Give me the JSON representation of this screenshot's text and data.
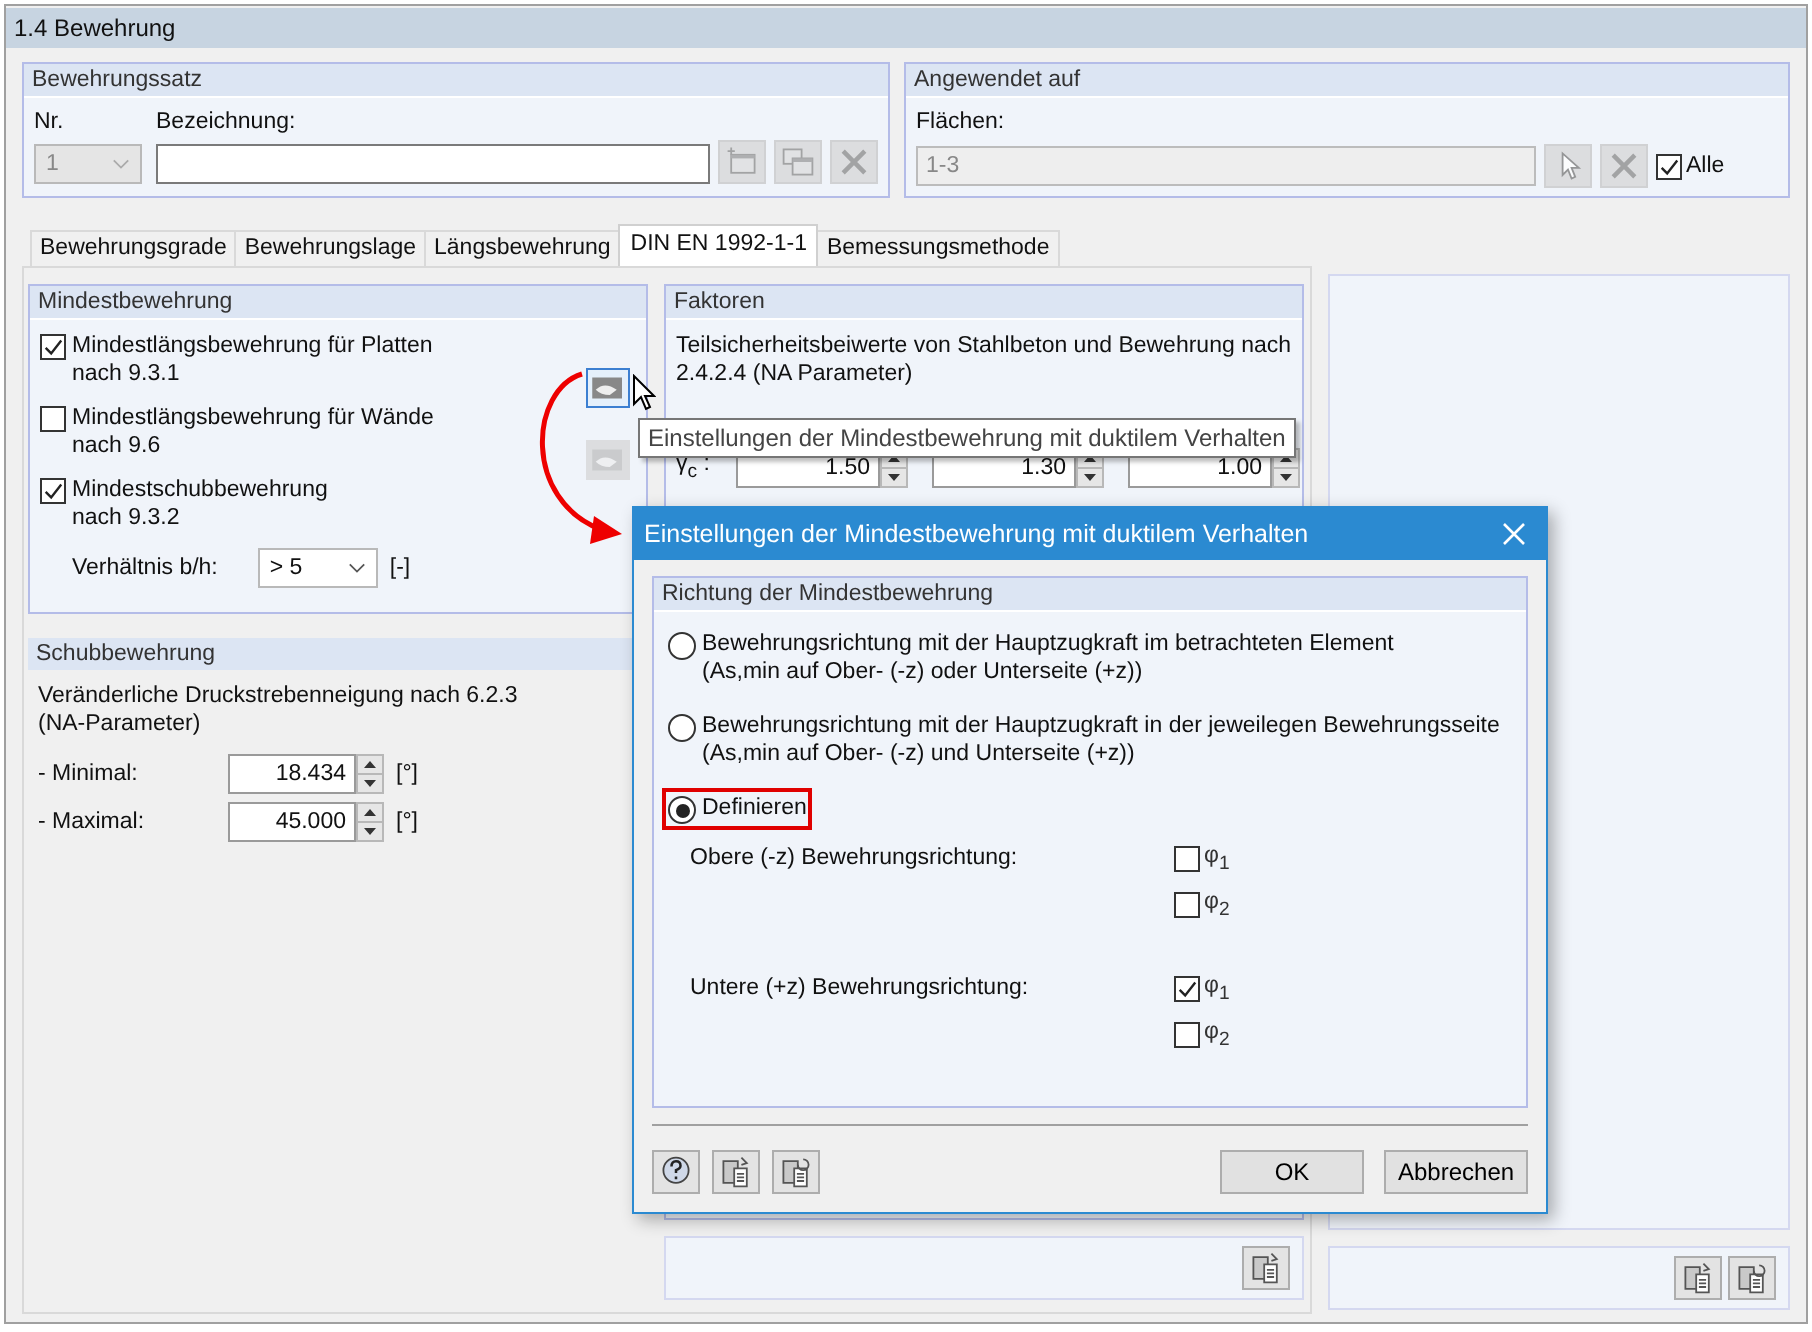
{
  "window": {
    "title": "1.4 Bewehrung"
  },
  "reinforcement_set": {
    "title": "Bewehrungssatz",
    "nr_label": "Nr.",
    "nr_value": "1",
    "name_label": "Bezeichnung:"
  },
  "applied_to": {
    "title": "Angewendet auf",
    "surfaces_label": "Flächen:",
    "surfaces_value": "1-3",
    "all": {
      "label": "Alle",
      "checked": true
    }
  },
  "tabs": [
    {
      "label": "Bewehrungsgrade",
      "selected": false
    },
    {
      "label": "Bewehrungslage",
      "selected": false
    },
    {
      "label": "Längsbewehrung",
      "selected": false
    },
    {
      "label": "DIN EN 1992-1-1",
      "selected": true
    },
    {
      "label": "Bemessungsmethode",
      "selected": false
    }
  ],
  "min_reinforcement": {
    "title": "Mindestbewehrung",
    "options": [
      {
        "label": "Mindestlängsbewehrung für Platten",
        "ref": "nach 9.3.1",
        "checked": true
      },
      {
        "label": "Mindestlängsbewehrung für Wände",
        "ref": "nach 9.6",
        "checked": false
      },
      {
        "label": "Mindestschubbewehrung",
        "ref": "nach 9.3.2",
        "checked": true
      }
    ],
    "ratio": {
      "label": "Verhältnis b/h:",
      "value": "> 5",
      "unit": "[-]"
    }
  },
  "shear": {
    "title": "Schubbewehrung",
    "description": "Veränderliche Druckstrebenneigung nach 6.2.3\n(NA-Parameter)",
    "fields": [
      {
        "label": "- Minimal:",
        "value": "18.434",
        "unit": "[°]"
      },
      {
        "label": "- Maximal:",
        "value": "45.000",
        "unit": "[°]"
      }
    ]
  },
  "factors": {
    "title": "Faktoren",
    "description": "Teilsicherheitsbeiwerte von Stahlbeton und Bewehrung nach\n2.4.2.4 (NA Parameter)",
    "rows": [
      {
        "label": "γ$_{c}$ :",
        "values": [
          "1.50",
          "1.30",
          "1.00"
        ]
      }
    ]
  },
  "tooltip": "Einstellungen der Mindestbewehrung mit duktilem Verhalten",
  "dialog": {
    "title": "Einstellungen der Mindestbewehrung mit duktilem Verhalten",
    "group_title": "Richtung der Mindestbewehrung",
    "options": [
      {
        "label": "Bewehrungsrichtung mit der Hauptzugkraft im betrachteten Element\n(As,min auf Ober- (-z) oder Unterseite (+z))",
        "selected": false
      },
      {
        "label": "Bewehrungsrichtung mit der Hauptzugkraft in der jeweilegen Bewehrungsseite\n(As,min auf Ober- (-z) und Unterseite (+z))",
        "selected": false
      },
      {
        "label": "Definieren",
        "selected": true
      }
    ],
    "directions": [
      {
        "label": "Obere (-z) Bewehrungsrichtung:",
        "checks": [
          {
            "label": "φ$_{1}$",
            "checked": false
          },
          {
            "label": "φ$_{2}$",
            "checked": false
          }
        ]
      },
      {
        "label": "Untere (+z) Bewehrungsrichtung:",
        "checks": [
          {
            "label": "φ$_{1}$",
            "checked": true
          },
          {
            "label": "φ$_{2}$",
            "checked": false
          }
        ]
      }
    ],
    "buttons": [
      "OK",
      "Abbrechen"
    ]
  }
}
